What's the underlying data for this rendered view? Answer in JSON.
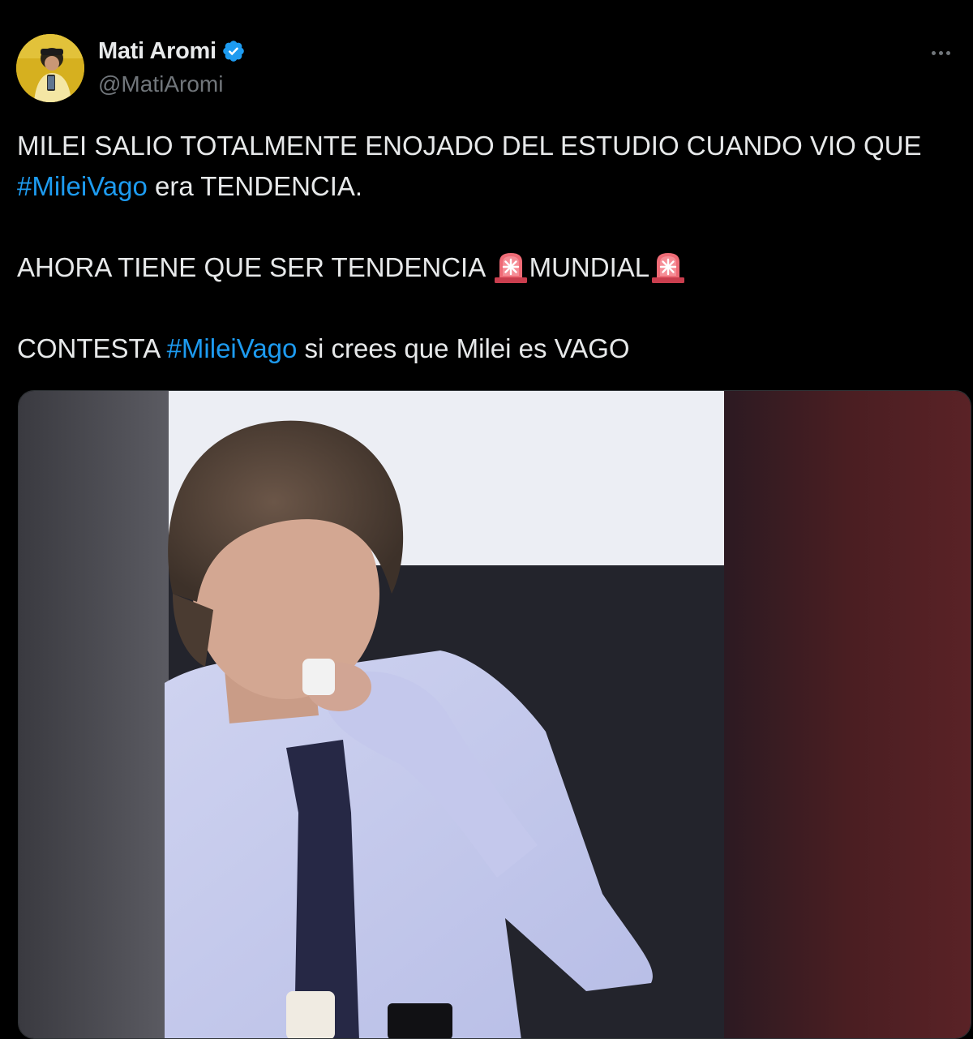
{
  "author": {
    "display_name": "Mati Aromi",
    "handle": "@MatiAromi",
    "verified": true,
    "verified_icon": "verified-badge-icon",
    "avatar_icon": "avatar"
  },
  "more_icon": "ellipsis-icon",
  "tweet": {
    "line1": "MILEI SALIO TOTALMENTE ENOJADO DEL ESTUDIO CUANDO VIO QUE",
    "line2_hashtag": "#MileiVago",
    "line2_rest": " era TENDENCIA.",
    "line3_part1": "AHORA TIENE QUE SER TENDENCIA ",
    "line3_emoji1": "police-siren-emoji",
    "line3_part2": "MUNDIAL",
    "line3_emoji2": "police-siren-emoji",
    "line4_part1": "CONTESTA ",
    "line4_hashtag": "#MileiVago",
    "line4_rest": " si crees que Milei es VAGO"
  },
  "colors": {
    "background": "#000000",
    "text": "#e7e9ea",
    "secondary_text": "#71767b",
    "link": "#1d9bf0",
    "verified": "#1d9bf0"
  }
}
